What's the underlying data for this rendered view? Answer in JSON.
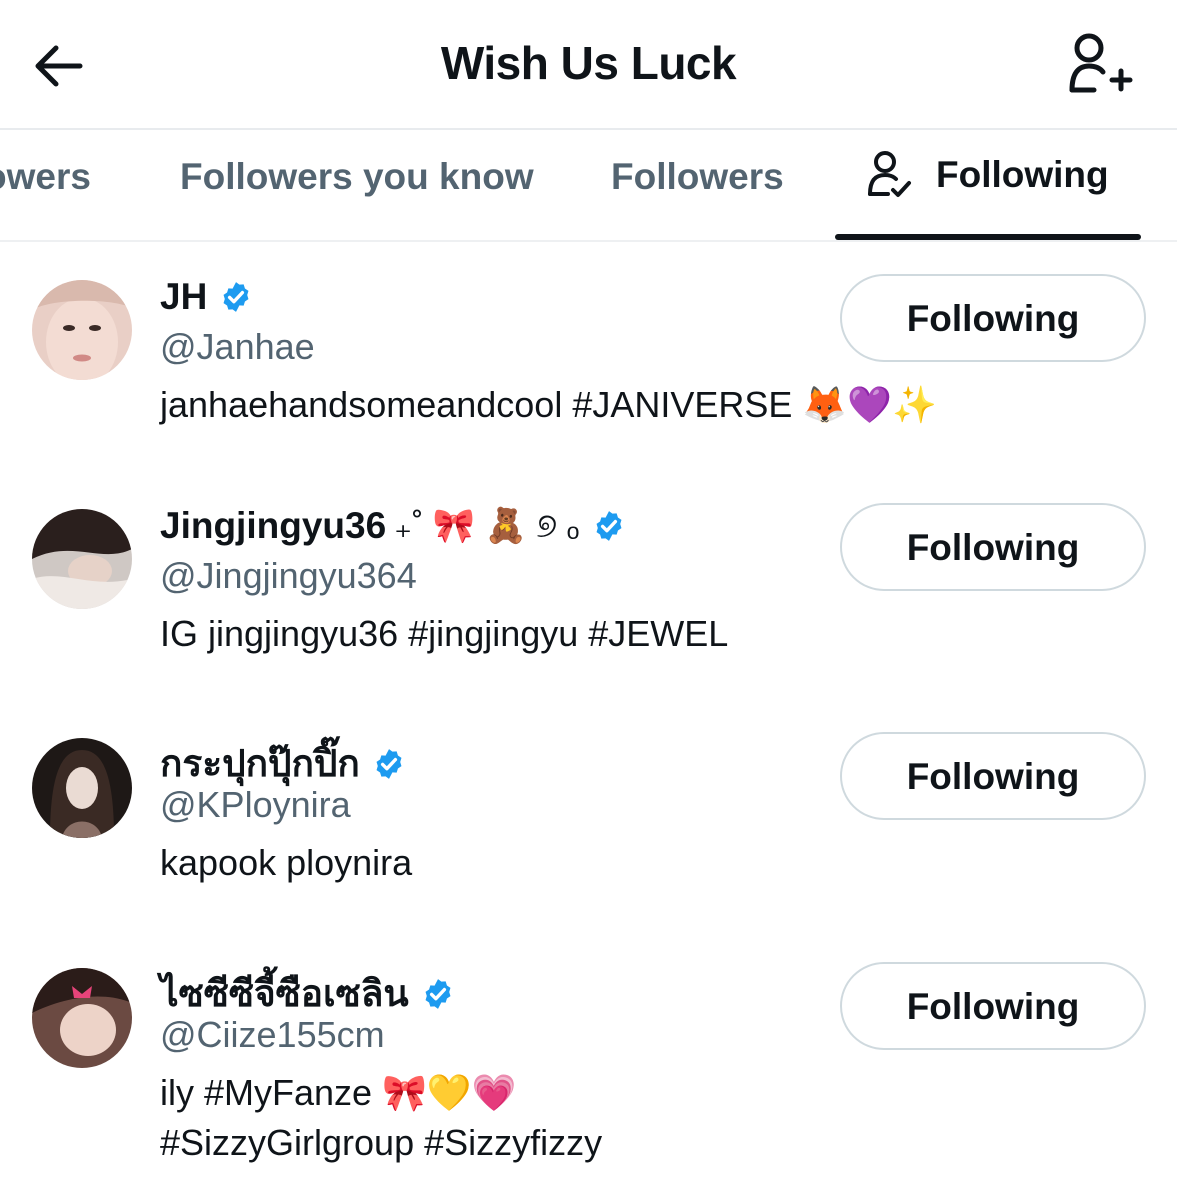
{
  "header": {
    "title": "Wish Us Luck",
    "back_icon": "arrow-left-icon",
    "action_icon": "add-user-icon"
  },
  "tabs": [
    {
      "label": "owers",
      "active": false
    },
    {
      "label": "Followers you know",
      "active": false
    },
    {
      "label": "Followers",
      "active": false
    },
    {
      "label": "Following",
      "active": true,
      "icon": "user-check-icon"
    }
  ],
  "colors": {
    "text_primary": "#0f1419",
    "text_secondary": "#536471",
    "verified_blue": "#1d9bf0",
    "border": "#cfd9de"
  },
  "users": [
    {
      "name": "JH",
      "decorations": "",
      "verified": true,
      "handle": "@Janhae",
      "bio": [
        "janhaehandsomeandcool #JANIVERSE 🦊💜✨"
      ],
      "button_label": "Following"
    },
    {
      "name": "Jingjingyu36",
      "decorations": "₊˚ 🎀 🧸 ୭ ₒ",
      "verified": true,
      "handle": "@Jingjingyu364",
      "bio": [
        "IG jingjingyu36 #jingjingyu #JEWEL"
      ],
      "button_label": "Following"
    },
    {
      "name": "กระปุกปุ๊กปิ๊ก",
      "decorations": "",
      "verified": true,
      "handle": "@KPloynira",
      "bio": [
        "kapook ploynira"
      ],
      "button_label": "Following"
    },
    {
      "name": "ไซซีซีจี้ซือเซลิน",
      "decorations": "",
      "verified": true,
      "handle": "@Ciize155cm",
      "bio": [
        "ily #MyFanze 🎀💛💗",
        "#SizzyGirlgroup #Sizzyfizzy"
      ],
      "button_label": "Following"
    }
  ]
}
